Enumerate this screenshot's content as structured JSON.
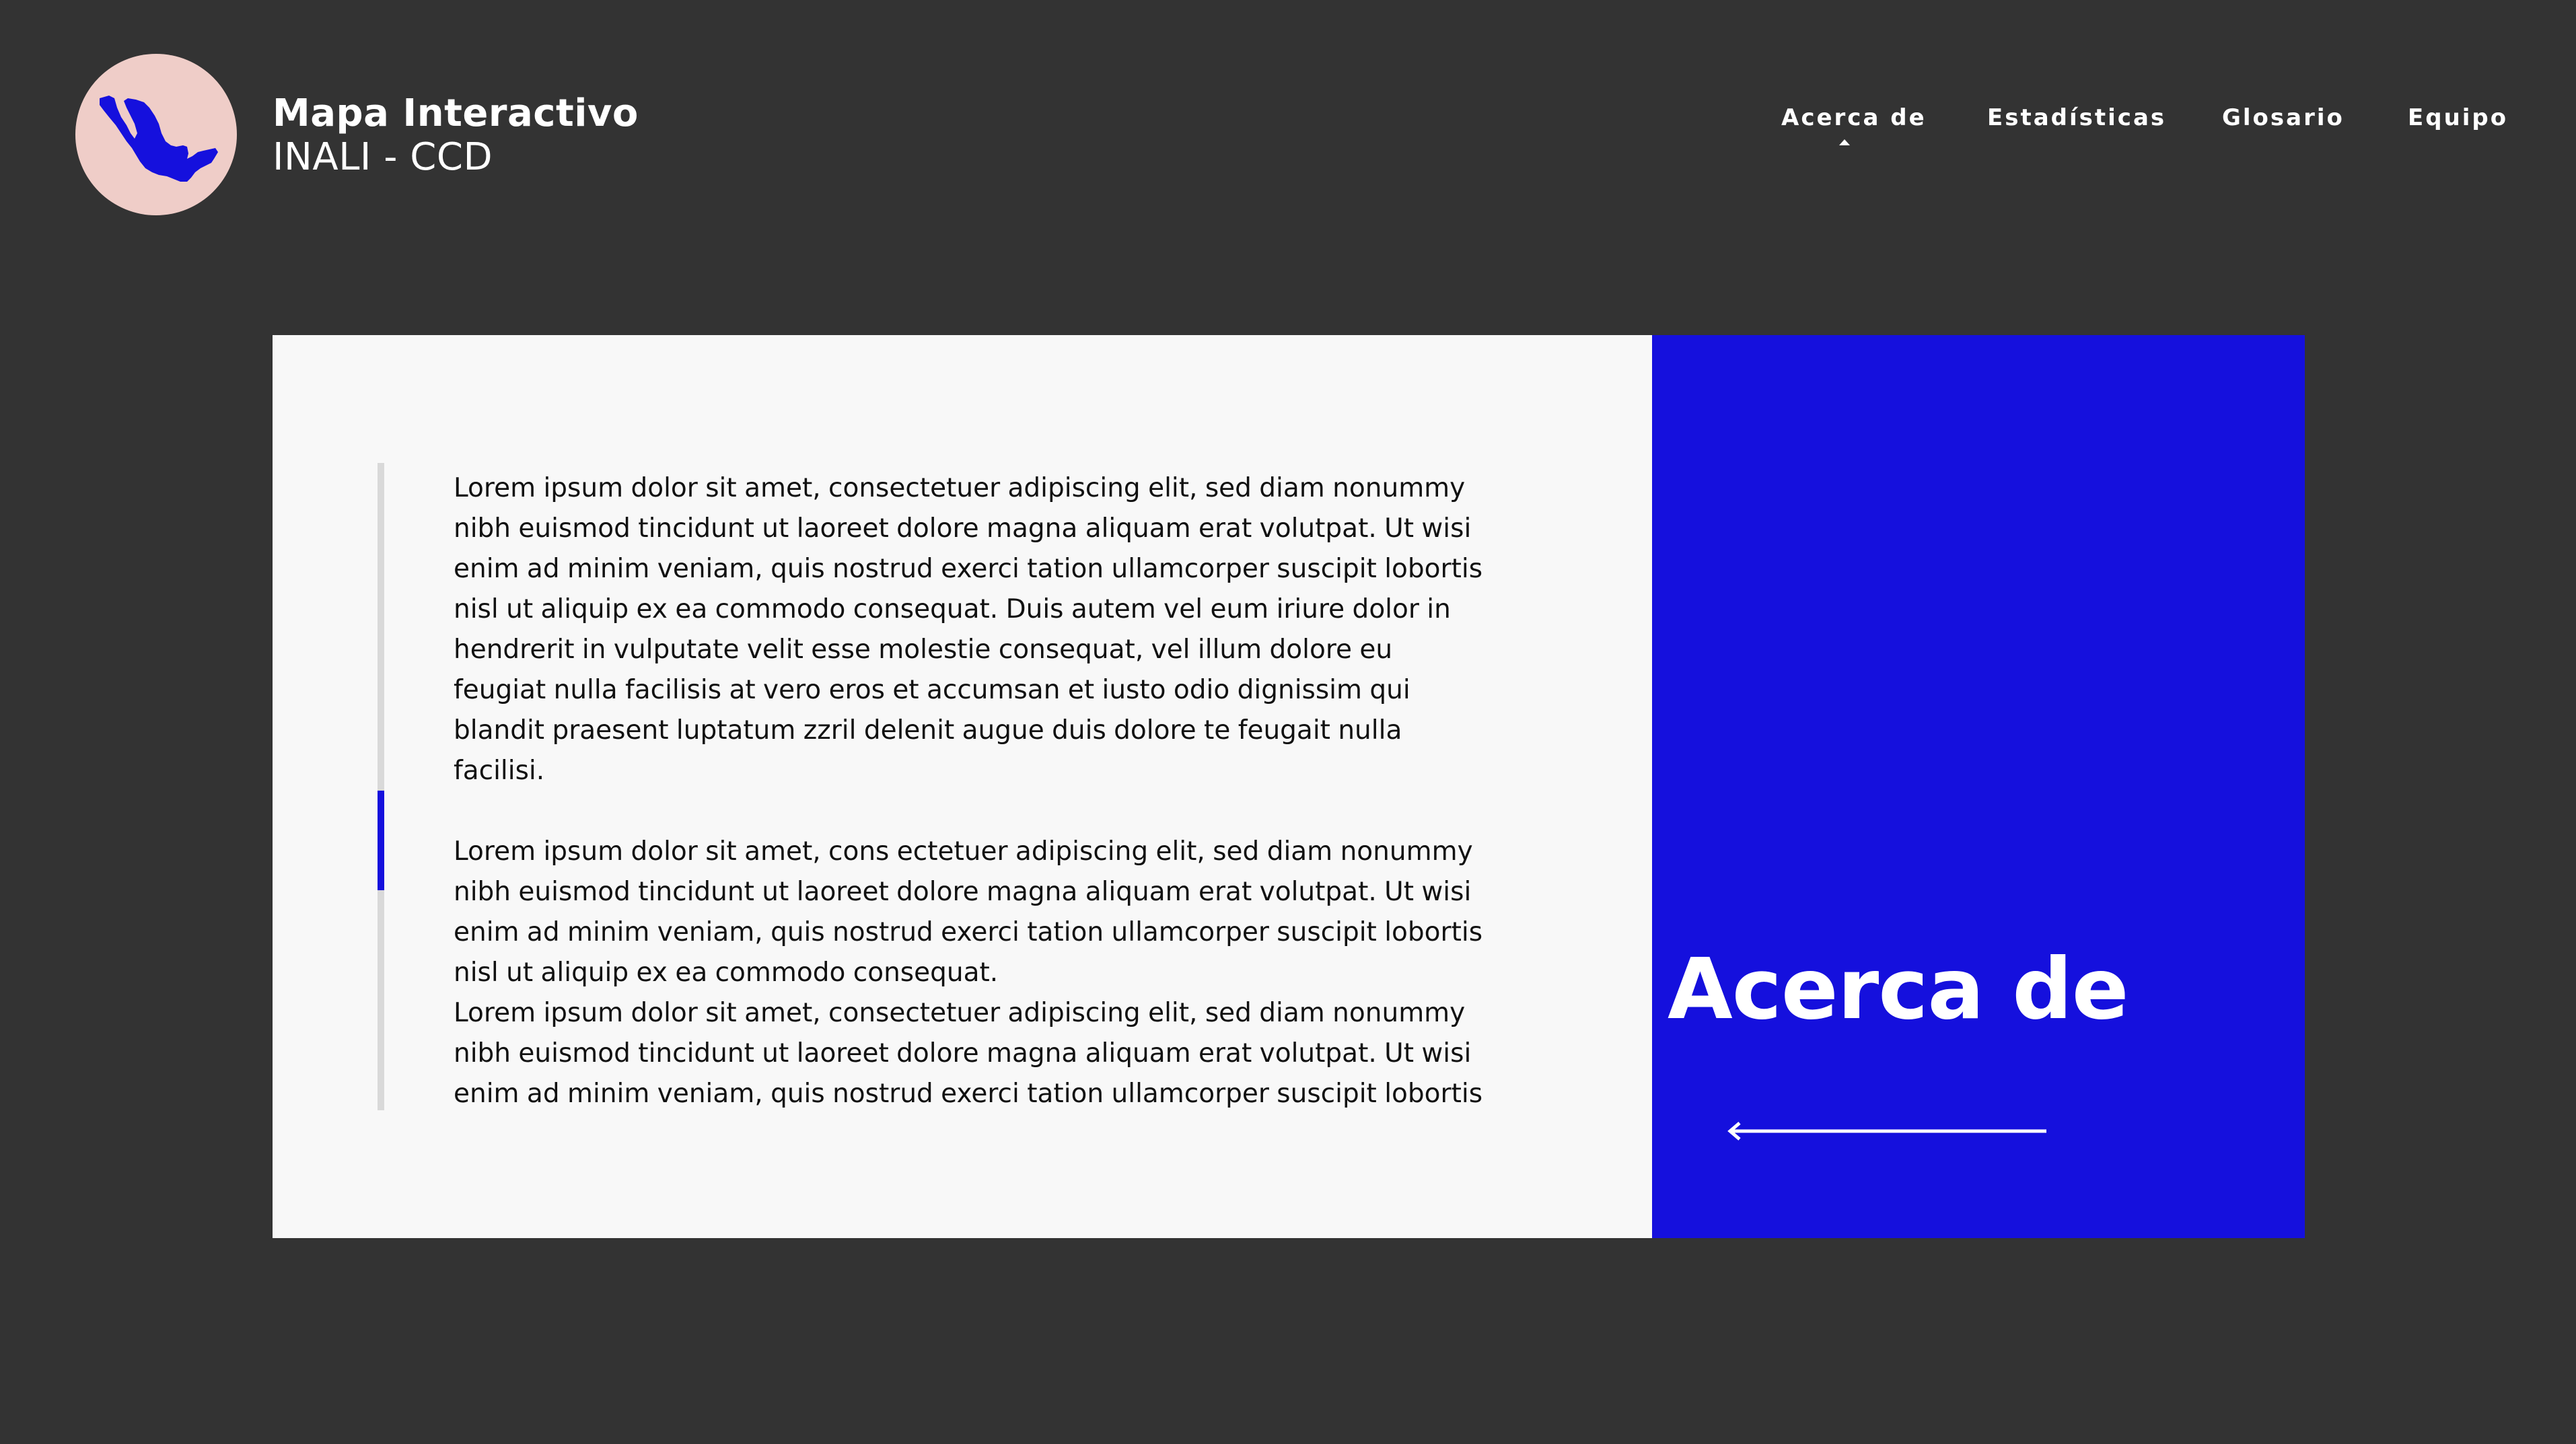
{
  "brand": {
    "title": "Mapa Interactivo",
    "subtitle": "INALI - CCD",
    "logo_icon": "mexico-map-icon"
  },
  "nav": {
    "items": [
      {
        "label": "Acerca de",
        "active": true
      },
      {
        "label": "Estadísticas",
        "active": false
      },
      {
        "label": "Glosario",
        "active": false
      },
      {
        "label": "Equipo",
        "active": false
      }
    ]
  },
  "content": {
    "paragraphs": [
      "Lorem ipsum dolor sit amet, consectetuer adipiscing elit, sed diam nonummy nibh euismod tincidunt ut laoreet dolore magna aliquam erat volutpat. Ut wisi enim ad minim veniam, quis nostrud exerci tation ullamcorper suscipit lobortis nisl ut aliquip ex ea commodo consequat. Duis autem vel eum iriure dolor in hendrerit in vulputate velit esse molestie consequat, vel illum dolore eu feugiat nulla facilisis at vero eros et accumsan et iusto odio dignissim qui blandit praesent luptatum zzril delenit augue duis dolore te feugait nulla facilisi.",
      "Lorem ipsum dolor sit amet, cons ectetuer adipiscing elit, sed diam nonummy nibh euismod tincidunt ut laoreet dolore magna aliquam erat volutpat. Ut wisi enim ad minim veniam, quis nostrud exerci tation ullamcorper suscipit lobortis nisl ut aliquip ex ea commodo consequat.",
      "Lorem ipsum dolor sit amet, consectetuer adipiscing elit, sed diam nonummy nibh euismod tincidunt ut laoreet dolore magna aliquam erat volutpat. Ut wisi enim ad minim veniam, quis nostrud exerci tation ullamcorper suscipit lobortis nisl ut aliquip ex ea commodo consequat. Duis autem vel eum iriure dolor in"
    ]
  },
  "section": {
    "title": "Acerca de",
    "back_icon": "arrow-left-icon"
  },
  "colors": {
    "background": "#333333",
    "accent": "#1510dd",
    "logo_bg": "#efcdc8",
    "panel_bg": "#f8f8f8",
    "scroll_track": "#d9d9d9",
    "text": "#111111"
  }
}
